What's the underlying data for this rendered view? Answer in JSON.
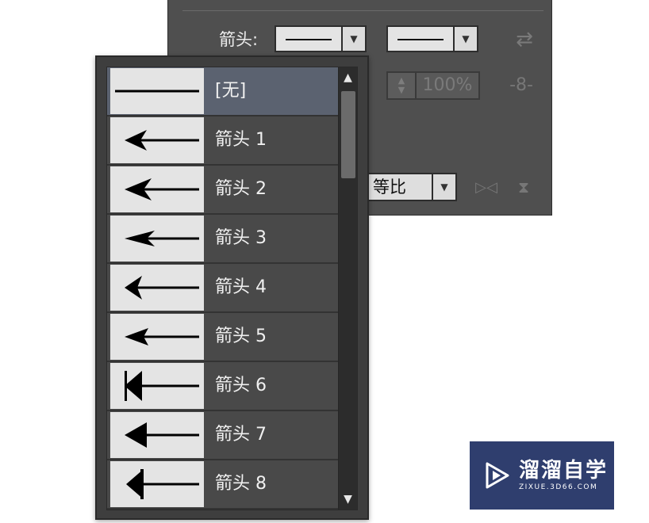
{
  "stroke_panel": {
    "arrowheads_label": "箭头:",
    "scale_value": "100%",
    "align_value": "等比",
    "icons": [
      "swap-arrows-icon",
      "link-icon",
      "flip-horizontal-icon",
      "flip-vertical-icon"
    ]
  },
  "dropdown": {
    "selected_index": 0,
    "options": [
      {
        "label": "[无]",
        "icon": "no-arrowhead"
      },
      {
        "label": "箭头 1",
        "icon": "arrowhead-1"
      },
      {
        "label": "箭头 2",
        "icon": "arrowhead-2"
      },
      {
        "label": "箭头 3",
        "icon": "arrowhead-3"
      },
      {
        "label": "箭头 4",
        "icon": "arrowhead-4"
      },
      {
        "label": "箭头 5",
        "icon": "arrowhead-5"
      },
      {
        "label": "箭头 6",
        "icon": "arrowhead-6"
      },
      {
        "label": "箭头 7",
        "icon": "arrowhead-7"
      },
      {
        "label": "箭头 8",
        "icon": "arrowhead-8"
      }
    ]
  },
  "watermark": {
    "title": "溜溜自学",
    "subtitle": "ZIXUE.3D66.COM"
  },
  "colors": {
    "panel_bg": "#4f4f4f",
    "dropdown_bg": "#3e3e3e",
    "selected_row": "#5b6270",
    "watermark_bg": "#2f3e6e"
  }
}
